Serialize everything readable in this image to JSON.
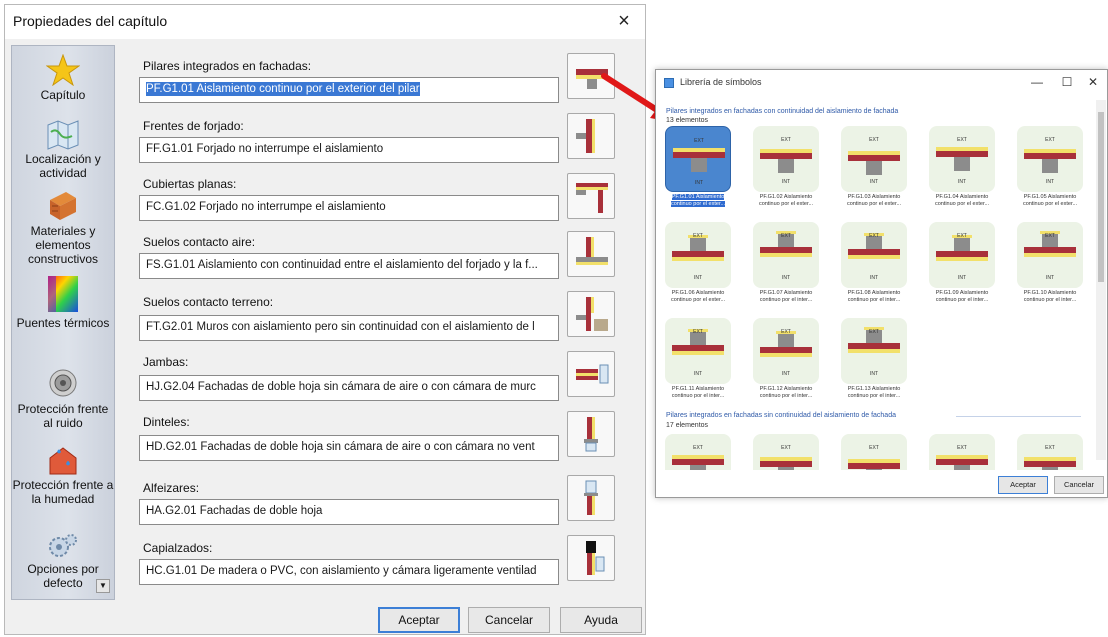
{
  "dialog": {
    "title": "Propiedades del capítulo",
    "close": "×",
    "sidebar": [
      {
        "label": "Capítulo",
        "icon": "star-icon"
      },
      {
        "label": "Localización y actividad",
        "icon": "map-icon"
      },
      {
        "label": "Materiales y elementos constructivos",
        "icon": "bricks-icon"
      },
      {
        "label": "Puentes térmicos",
        "icon": "thermal-bridge-icon"
      },
      {
        "label": "Protección frente al ruido",
        "icon": "speaker-icon"
      },
      {
        "label": "Protección frente a la humedad",
        "icon": "moisture-icon"
      },
      {
        "label": "Opciones por defecto",
        "icon": "settings-gears-icon"
      }
    ],
    "fields": [
      {
        "label": "Pilares integrados en fachadas:",
        "value": "PF.G1.01 Aislamiento continuo por el exterior del pilar"
      },
      {
        "label": "Frentes de forjado:",
        "value": "FF.G1.01 Forjado no interrumpe el aislamiento"
      },
      {
        "label": "Cubiertas planas:",
        "value": "FC.G1.02 Forjado no interrumpe el aislamiento"
      },
      {
        "label": "Suelos contacto aire:",
        "value": "FS.G1.01 Aislamiento con continuidad entre el aislamiento del forjado y la f..."
      },
      {
        "label": "Suelos contacto terreno:",
        "value": "FT.G2.01 Muros con aislamiento pero sin continuidad con el aislamiento de l"
      },
      {
        "label": "Jambas:",
        "value": "HJ.G2.04 Fachadas de doble hoja sin cámara de aire o con cámara de murc"
      },
      {
        "label": "Dinteles:",
        "value": "HD.G2.01 Fachadas de doble hoja sin cámara de aire o con cámara no vent"
      },
      {
        "label": "Alfeizares:",
        "value": "HA.G2.01 Fachadas de doble hoja"
      },
      {
        "label": "Capialzados:",
        "value": "HC.G1.01 De madera o PVC, con aislamiento y cámara ligeramente ventilad"
      }
    ],
    "buttons": {
      "ok": "Aceptar",
      "cancel": "Cancelar",
      "help": "Ayuda"
    }
  },
  "library": {
    "title": "Librería de símbolos",
    "window_controls": {
      "minimize": "—",
      "maximize": "☐",
      "close": "✕"
    },
    "group1": {
      "title": "Pilares integrados en fachadas con continuidad del aislamiento de fachada",
      "count": "13 elementos",
      "items": [
        {
          "line1": "PF.G1.01 Aislamiento",
          "line2": "continuo por el exter..."
        },
        {
          "line1": "PF.G1.02 Aislamiento",
          "line2": "continuo por el exter..."
        },
        {
          "line1": "PF.G1.03 Aislamiento",
          "line2": "continuo por el exter..."
        },
        {
          "line1": "PF.G1.04 Aislamiento",
          "line2": "continuo por el exter..."
        },
        {
          "line1": "PF.G1.05 Aislamiento",
          "line2": "continuo por el exter..."
        },
        {
          "line1": "PF.G1.06 Aislamiento",
          "line2": "continuo por el exter..."
        },
        {
          "line1": "PF.G1.07 Aislamiento",
          "line2": "continuo por el inter..."
        },
        {
          "line1": "PF.G1.08 Aislamiento",
          "line2": "continuo por el inter..."
        },
        {
          "line1": "PF.G1.09 Aislamiento",
          "line2": "continuo por el inter..."
        },
        {
          "line1": "PF.G1.10 Aislamiento",
          "line2": "continuo por el inter..."
        },
        {
          "line1": "PF.G1.11 Aislamiento",
          "line2": "continuo por el inter..."
        },
        {
          "line1": "PF.G1.12 Aislamiento",
          "line2": "continuo por el inter..."
        },
        {
          "line1": "PF.G1.13 Aislamiento",
          "line2": "continuo por el inter..."
        }
      ]
    },
    "group2": {
      "title": "Pilares integrados en fachadas sin continuidad del aislamiento de fachada",
      "count": "17 elementos"
    },
    "buttons": {
      "ok": "Aceptar",
      "cancel": "Cancelar"
    }
  },
  "symbol_text": {
    "ext": "EXT",
    "int": "INT"
  },
  "colors": {
    "wall": "#a8303a",
    "insulation": "#f2e06a",
    "pillar": "#8c8c8c",
    "selection": "#3a78d4",
    "arrow": "#e01818"
  }
}
